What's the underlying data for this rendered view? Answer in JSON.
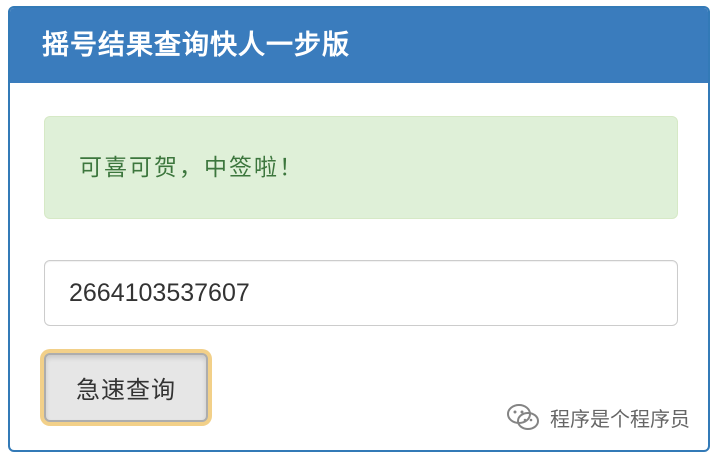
{
  "panel": {
    "title": "摇号结果查询快人一步版"
  },
  "alert": {
    "message": "可喜可贺，中签啦！"
  },
  "search": {
    "value": "2664103537607"
  },
  "button": {
    "label": "急速查询"
  },
  "watermark": {
    "text": "程序是个程序员",
    "icon": "wechat-icon"
  },
  "colors": {
    "heading_bg": "#3a7cbd",
    "alert_bg": "#dff0d8",
    "alert_text": "#3c763d",
    "button_focus": "#e8aa28"
  }
}
